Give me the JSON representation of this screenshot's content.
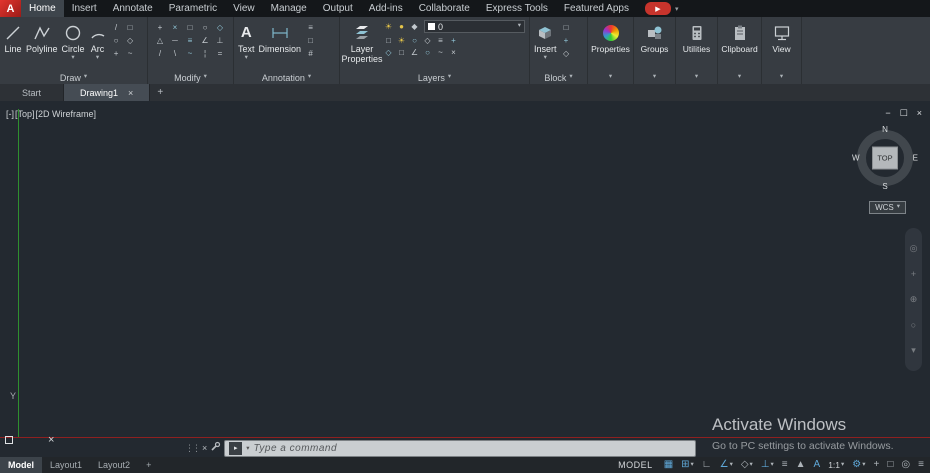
{
  "glyphs": {
    "caret_down": "▾",
    "close": "×",
    "minimize": "−",
    "restore": "☐",
    "play": "▶",
    "plus": "+",
    "grip": "⋮⋮",
    "prompt_arrow": "▸",
    "cursor_cross": "×",
    "draw_extra": [
      "/",
      "□",
      "○",
      "◇",
      "+",
      "~"
    ],
    "modify": [
      "+",
      "×",
      "□",
      "○",
      "◇",
      "△",
      "─",
      "≡",
      "∠",
      "⊥",
      "/",
      "\\",
      "~",
      "¦",
      "="
    ],
    "annotation_extra": [
      "≡",
      "□",
      "#"
    ],
    "layers_row1": [
      "☀",
      "●",
      "◆"
    ],
    "layers_row2": [
      "□",
      "☀",
      "○",
      "◇",
      "≡",
      "+"
    ],
    "layers_row3": [
      "◇",
      "□",
      "∠",
      "○",
      "~",
      "×"
    ],
    "block_extra": [
      "□",
      "+",
      "◇"
    ],
    "navbar": [
      "◎",
      "+",
      "⊕",
      "○",
      "▾"
    ],
    "status": [
      "▦",
      "⊞",
      "∟",
      "∠",
      "◇",
      "⊥",
      "≡",
      "▲",
      "A",
      "⚙",
      "+",
      "□",
      "◎",
      "≡"
    ]
  },
  "menubar": {
    "logo": "A",
    "tabs": [
      "Home",
      "Insert",
      "Annotate",
      "Parametric",
      "View",
      "Manage",
      "Output",
      "Add-ins",
      "Collaborate",
      "Express Tools",
      "Featured Apps"
    ]
  },
  "ribbon": {
    "draw": {
      "label": "Draw",
      "line": "Line",
      "polyline": "Polyline",
      "circle": "Circle",
      "arc": "Arc"
    },
    "modify": {
      "label": "Modify"
    },
    "annotation": {
      "label": "Annotation",
      "text": "Text",
      "dimension": "Dimension"
    },
    "layers": {
      "label": "Layers",
      "layer_properties": "Layer Properties",
      "current_layer": "0"
    },
    "block": {
      "label": "Block",
      "insert": "Insert"
    },
    "properties_label": "Properties",
    "groups_label": "Groups",
    "utilities_label": "Utilities",
    "clipboard_label": "Clipboard",
    "view_label": "View"
  },
  "filetabs": {
    "start": "Start",
    "drawing1": "Drawing1"
  },
  "canvas": {
    "vp_controls": "[-]",
    "vp_view": "[Top]",
    "vp_style": "[2D Wireframe]",
    "viewcube": {
      "n": "N",
      "e": "E",
      "s": "S",
      "w": "W",
      "top": "TOP"
    },
    "wcs": "WCS",
    "y_label": "Y",
    "watermark_line1": "Activate Windows",
    "watermark_line2": "Go to PC settings to activate Windows."
  },
  "command": {
    "placeholder": "Type  a  command"
  },
  "statusbar": {
    "model_tab": "Model",
    "layout1_tab": "Layout1",
    "layout2_tab": "Layout2",
    "space_label": "MODEL",
    "scale": "1:1"
  }
}
